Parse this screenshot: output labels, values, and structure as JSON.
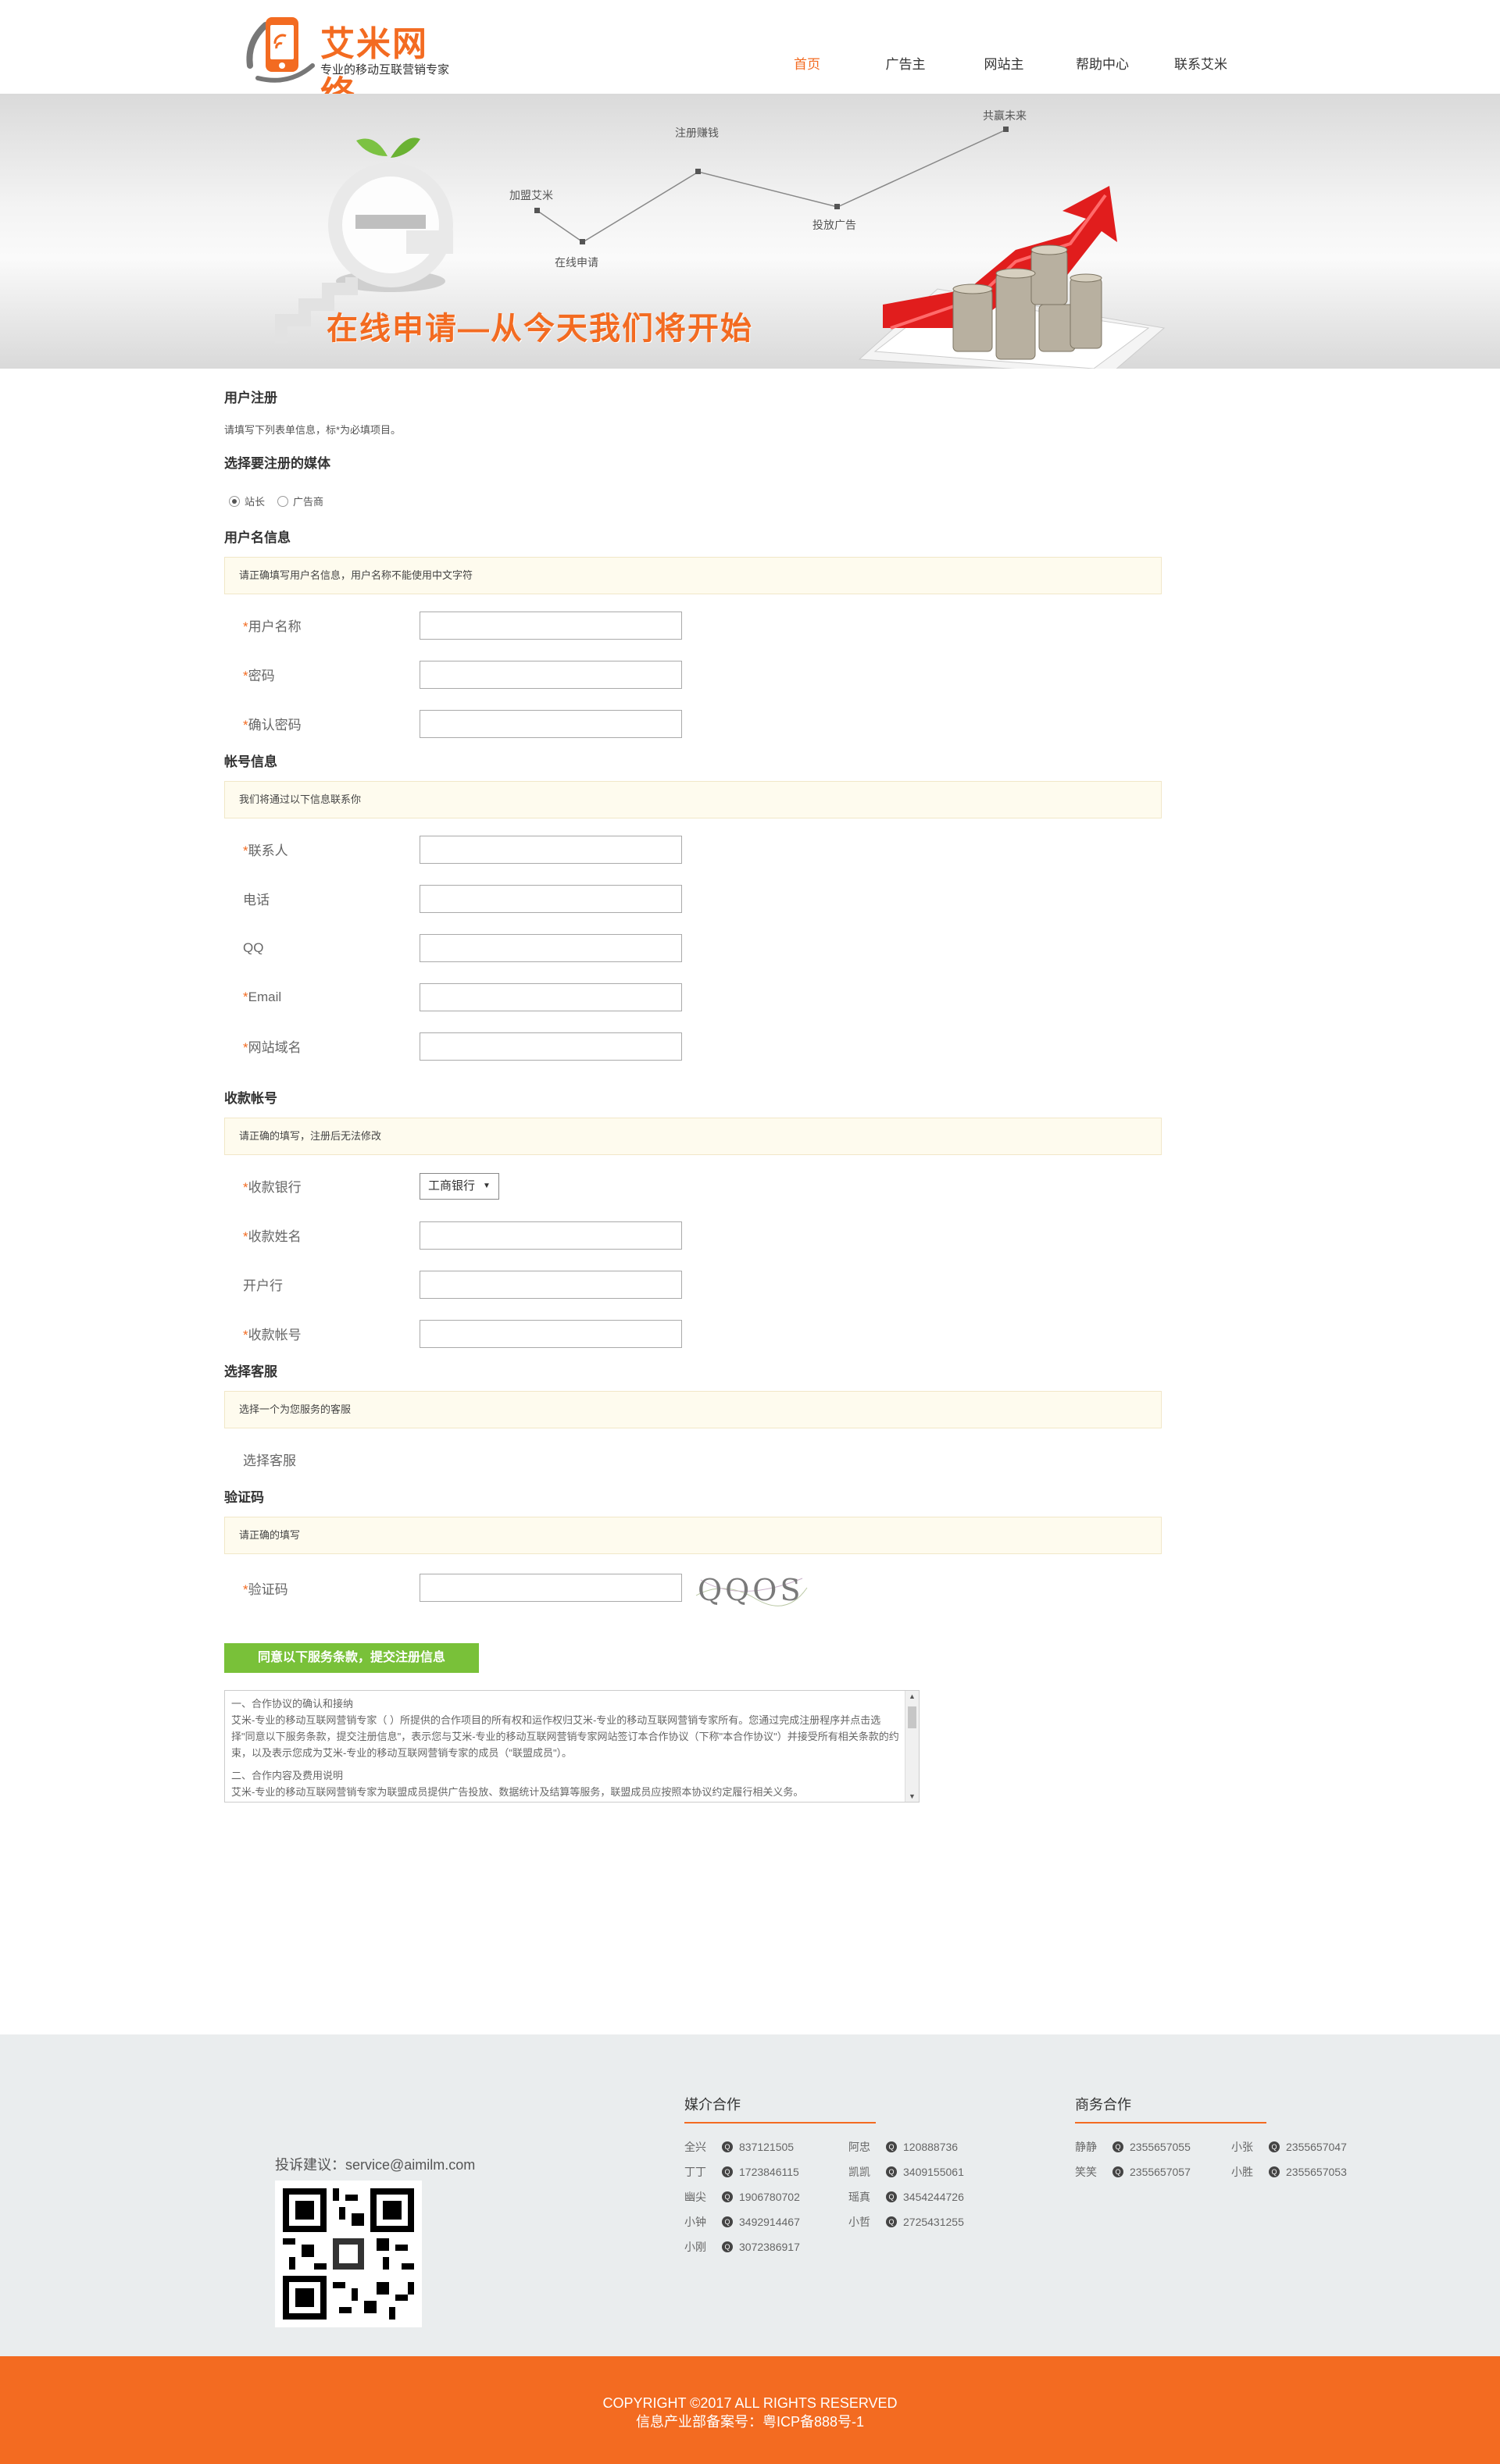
{
  "header": {
    "logo_text": "艾米网络",
    "logo_sub": "专业的移动互联营销专家",
    "nav": [
      "首页",
      "广告主",
      "网站主",
      "帮助中心",
      "联系艾米"
    ]
  },
  "banner": {
    "slogan": "在线申请—从今天我们将开始",
    "steps": [
      "加盟艾米",
      "在线申请",
      "注册赚钱",
      "投放广告",
      "共赢未来"
    ]
  },
  "form": {
    "title": "用户注册",
    "desc": "请填写下列表单信息，标*为必填项目。",
    "media_title": "选择要注册的媒体",
    "media_options": [
      "站长",
      "广告商"
    ],
    "username_section": {
      "title": "用户名信息",
      "notice": "请正确填写用户名信息，用户名称不能使用中文字符",
      "fields": [
        "用户名称",
        "密码",
        "确认密码"
      ]
    },
    "account_section": {
      "title": "帐号信息",
      "notice": "我们将通过以下信息联系你",
      "fields": [
        {
          "label": "联系人",
          "required": true
        },
        {
          "label": "电话",
          "required": false
        },
        {
          "label": "QQ",
          "required": false
        },
        {
          "label": "Email",
          "required": true
        },
        {
          "label": "网站域名",
          "required": true
        }
      ]
    },
    "payment_section": {
      "title": "收款帐号",
      "notice": "请正确的填写，注册后无法修改",
      "bank_label": "收款银行",
      "bank_selected": "工商银行",
      "fields": [
        {
          "label": "收款姓名",
          "required": true
        },
        {
          "label": "开户行",
          "required": false
        },
        {
          "label": "收款帐号",
          "required": true
        }
      ]
    },
    "service_section": {
      "title": "选择客服",
      "notice": "选择一个为您服务的客服",
      "label": "选择客服"
    },
    "captcha_section": {
      "title": "验证码",
      "notice": "请正确的填写",
      "label": "验证码",
      "captcha_text": "QQOS"
    },
    "submit_label": "同意以下服务条款，提交注册信息",
    "terms": [
      "一、合作协议的确认和接纳",
      "艾米-专业的移动互联网营销专家（ ）所提供的合作项目的所有权和运作权归艾米-专业的移动互联网营销专家所有。您通过完成注册程序并点击选择\"同意以下服务条款，提交注册信息\"，表示您与艾米-专业的移动互联网营销专家网站签订本合作协议（下称\"本合作协议\"）并接受所有相关条款的约束，以及表示您成为艾米-专业的移动互联网营销专家的成员（\"联盟成员\"）。",
      "二、合作内容及费用说明",
      "艾米-专业的移动互联网营销专家为联盟成员提供广告投放、数据统计及结算等服务，联盟成员应按照本协议约定履行相关义务。"
    ]
  },
  "footer": {
    "complain": "投诉建议：service@aimilm.com",
    "media_title": "媒介合作",
    "media_contacts": [
      {
        "name": "全兴",
        "qq": "837121505"
      },
      {
        "name": "阿忠",
        "qq": "120888736"
      },
      {
        "name": "丁丁",
        "qq": "1723846115"
      },
      {
        "name": "凯凯",
        "qq": "3409155061"
      },
      {
        "name": "幽尖",
        "qq": "1906780702"
      },
      {
        "name": "瑶真",
        "qq": "3454244726"
      },
      {
        "name": "小钟",
        "qq": "3492914467"
      },
      {
        "name": "小哲",
        "qq": "2725431255"
      },
      {
        "name": "小刚",
        "qq": "3072386917"
      }
    ],
    "biz_title": "商务合作",
    "biz_contacts": [
      {
        "name": "静静",
        "qq": "2355657055"
      },
      {
        "name": "小张",
        "qq": "2355657047"
      },
      {
        "name": "笑笑",
        "qq": "2355657057"
      },
      {
        "name": "小胜",
        "qq": "2355657053"
      }
    ],
    "copyright": "COPYRIGHT ©2017 ALL RIGHTS RESERVED",
    "icp": "信息产业部备案号：粤ICP备888号-1"
  },
  "colors": {
    "brand": "#f36b21",
    "submit": "#79c139",
    "notice_bg": "#fefbee",
    "footer_bg": "#eaedee"
  }
}
